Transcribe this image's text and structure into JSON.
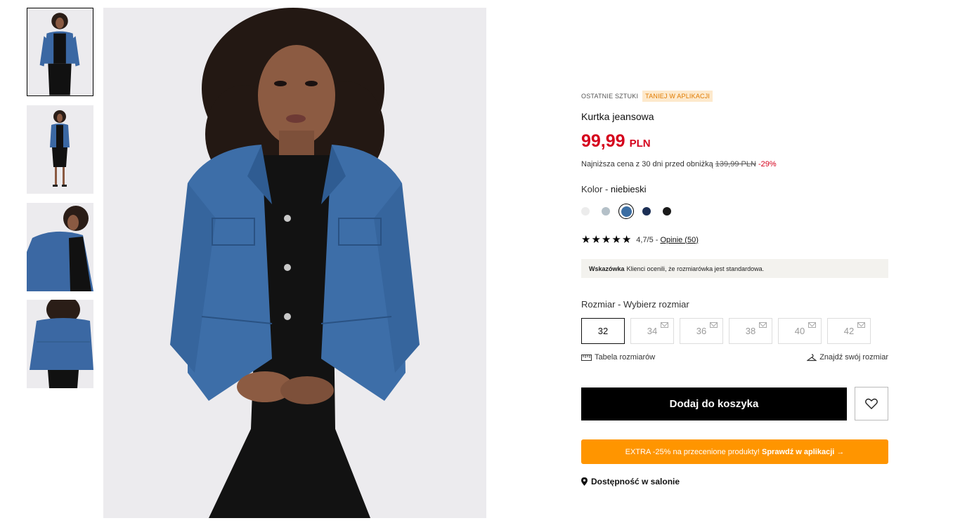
{
  "gallery": {
    "thumbnails": [
      {
        "label": "front view"
      },
      {
        "label": "full body view"
      },
      {
        "label": "side view"
      },
      {
        "label": "back view"
      }
    ]
  },
  "product": {
    "badge_last": "OSTATNIE SZTUKI",
    "badge_app": "TANIEJ W APLIKACJI",
    "title": "Kurtka jeansowa",
    "price": "99,99",
    "currency": "PLN",
    "lowest_prefix": "Najniższa cena z 30 dni przed obniżką",
    "lowest_old": "139,99 PLN",
    "lowest_discount": "-29%",
    "color_label": "Kolor - ",
    "color_value": "niebieski",
    "swatches": [
      "#ececec",
      "#b4c0c8",
      "#3c6ea3",
      "#1c2f55",
      "#1a1a1a"
    ],
    "rating_value": "4,7/5 -",
    "rating_stars": 5,
    "reviews_link": "Opinie (50)",
    "hint_bold": "Wskazówka",
    "hint_text": "Klienci ocenili, że rozmiarówka jest standardowa.",
    "size_label": "Rozmiar - Wybierz rozmiar",
    "sizes": [
      "32",
      "34",
      "36",
      "38",
      "40",
      "42"
    ],
    "size_table_link": "Tabela rozmiarów",
    "find_size_link": "Znajdź swój rozmiar",
    "add_to_cart": "Dodaj do koszyka",
    "promo_text": "EXTRA -25% na przecenione produkty!",
    "promo_link": "Sprawdź w aplikacji →",
    "store_availability": "Dostępność w salonie"
  },
  "colors": {
    "price_red": "#d5001c",
    "promo_orange": "#ff9500",
    "app_badge_bg": "#fde9cc"
  }
}
